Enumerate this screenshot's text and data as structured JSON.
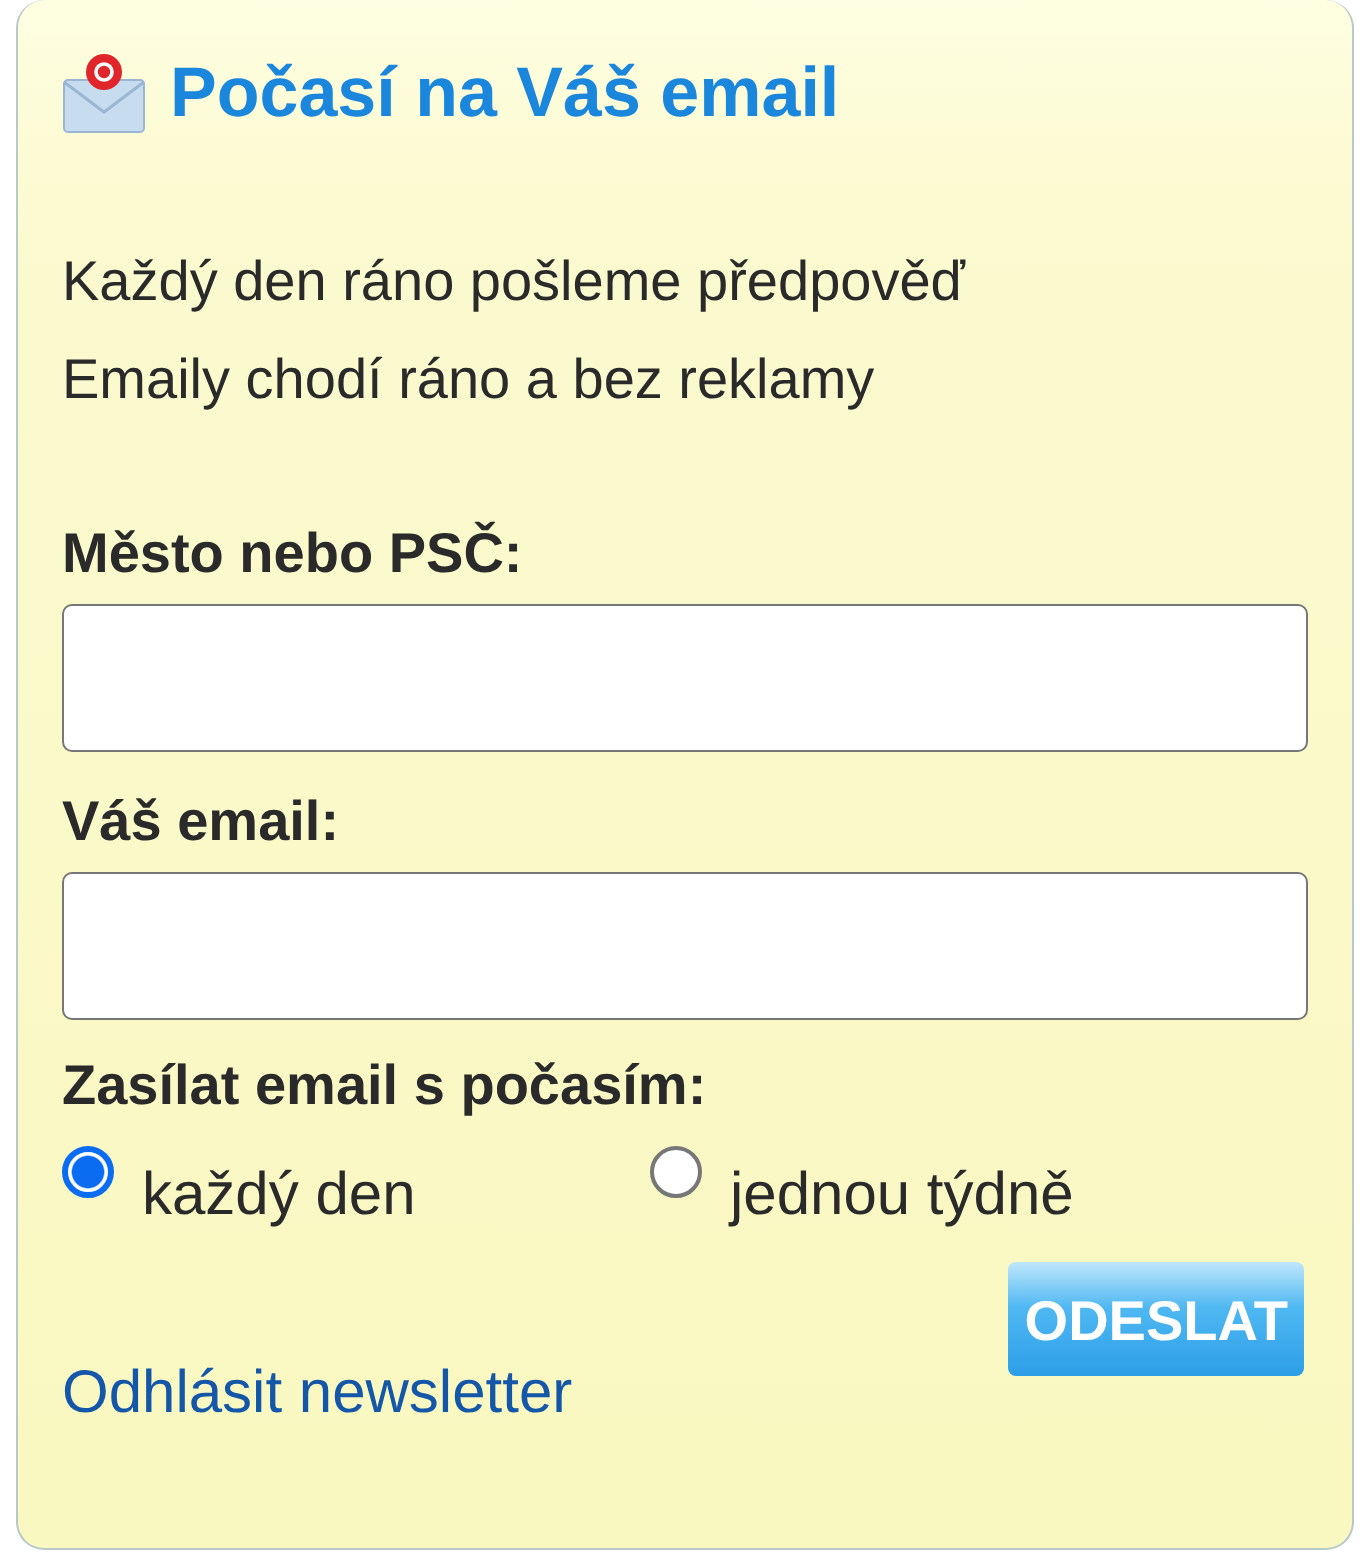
{
  "title": "Počasí na Váš email",
  "intro": [
    "Každý den ráno pošleme předpověď",
    "Emaily chodí ráno a bez reklamy"
  ],
  "fields": [
    {
      "label": "Město nebo PSČ:"
    },
    {
      "label": "Váš email:"
    }
  ],
  "frequency": {
    "label": "Zasílat email s počasím:",
    "options": [
      {
        "label": "každý den",
        "selected": true
      },
      {
        "label": "jednou týdně",
        "selected": false
      }
    ]
  },
  "submit": "ODESLAT",
  "unsubscribe": "Odhlásit newsletter"
}
